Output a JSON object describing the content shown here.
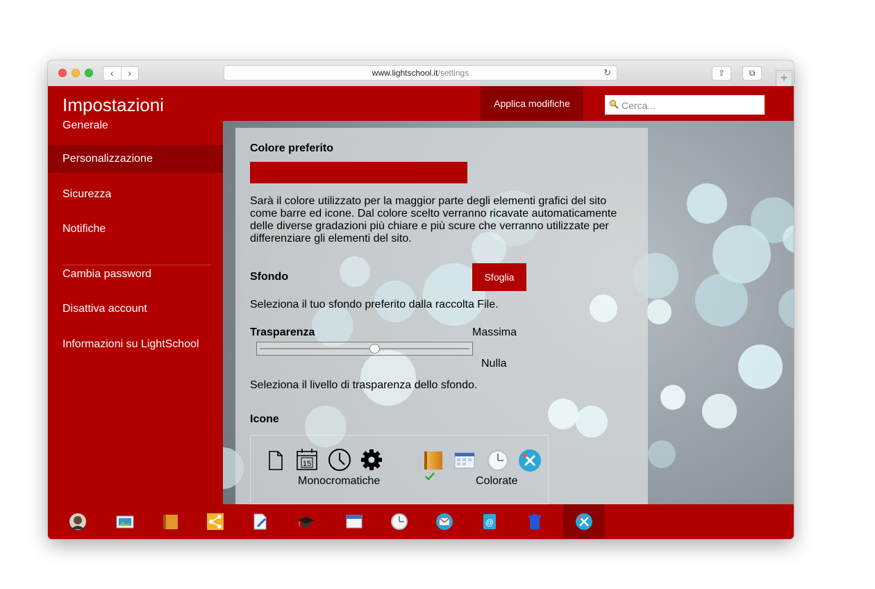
{
  "browser": {
    "url_domain": "www.lightschool.it",
    "url_path": "/settings",
    "back_symbol": "‹",
    "forward_symbol": "›",
    "reload_symbol": "↻",
    "share_symbol": "⇪",
    "tabs_symbol": "⧉",
    "newtab_symbol": "+"
  },
  "header": {
    "title": "Impostazioni",
    "apply_label": "Applica modifiche",
    "search_placeholder": "Cerca..."
  },
  "sidebar": {
    "items": [
      {
        "label": "Generale"
      },
      {
        "label": "Personalizzazione",
        "active": true
      },
      {
        "label": "Sicurezza"
      },
      {
        "label": "Notifiche"
      },
      {
        "label": "Cambia password"
      },
      {
        "label": "Disattiva account"
      },
      {
        "label": "Informazioni su LightSchool"
      }
    ]
  },
  "settings": {
    "favorite_color": {
      "heading": "Colore preferito",
      "value": "#b20000",
      "description": "Sarà il colore utilizzato per la maggior parte degli elementi grafici del sito come barre ed icone. Dal colore scelto verranno ricavate automaticamente delle diverse gradazioni più chiare e più scure che verranno utilizzate per differenziare gli elementi del sito."
    },
    "background": {
      "heading": "Sfondo",
      "browse_label": "Sfoglia",
      "description": "Seleziona il tuo sfondo preferito dalla raccolta File."
    },
    "transparency": {
      "heading": "Trasparenza",
      "max_label": "Massima",
      "min_label": "Nulla",
      "value": 0.55,
      "description": "Seleziona il livello di trasparenza dello sfondo."
    },
    "icons": {
      "heading": "Icone",
      "monochrome_label": "Monocromatiche",
      "colored_label": "Colorate",
      "calendar_day": "15",
      "selected": "colored"
    }
  },
  "colors": {
    "accent": "#b20000",
    "accent_dark": "#8a0000"
  },
  "taskbar": {
    "icons": [
      "avatar-icon",
      "photo-icon",
      "notebook-icon",
      "share-icon",
      "edit-document-icon",
      "graduation-cap-icon",
      "calendar-icon",
      "clock-icon",
      "mail-icon",
      "contacts-icon",
      "trash-icon",
      "settings-tools-icon"
    ],
    "active": "settings-tools-icon"
  }
}
